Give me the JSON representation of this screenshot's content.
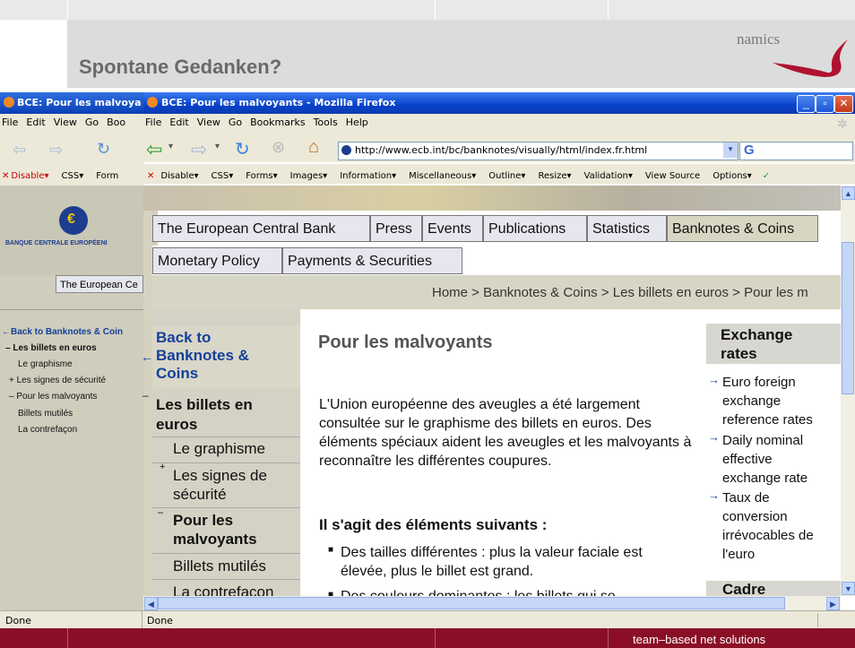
{
  "slide": {
    "title": "Spontane Gedanken?",
    "logo_text": "namics",
    "footer": "team–based net solutions"
  },
  "back_window": {
    "title": "BCE: Pour les malvoya",
    "menu": [
      "File",
      "Edit",
      "View",
      "Go",
      "Boo"
    ],
    "toolbar": [
      "Disable▾",
      "CSS▾",
      "Form"
    ],
    "bank_name": "BANQUE CENTRALE EUROPÉENI",
    "tab": "The European Ce",
    "nav": {
      "back": "←Back to Banknotes & Coin",
      "current": "– Les billets en euros",
      "items": [
        "Le graphisme",
        "+ Les signes de sécurité",
        "– Pour les malvoyants",
        "Billets mutilés",
        "La contrefaçon"
      ]
    },
    "status": "Done"
  },
  "window": {
    "title": "BCE: Pour les malvoyants - Mozilla Firefox",
    "menu": [
      "File",
      "Edit",
      "View",
      "Go",
      "Bookmarks",
      "Tools",
      "Help"
    ],
    "url": "http://www.ecb.int/bc/banknotes/visually/html/index.fr.html",
    "toolbar": [
      "Disable▾",
      "CSS▾",
      "Forms▾",
      "Images▾",
      "Information▾",
      "Miscellaneous▾",
      "Outline▾",
      "Resize▾",
      "Validation▾",
      "View Source",
      "Options▾"
    ],
    "status": "Done"
  },
  "tabs_row1": [
    "The European Central Bank",
    "Press",
    "Events",
    "Publications",
    "Statistics",
    "Banknotes & Coins"
  ],
  "tabs_row2": [
    "Monetary Policy",
    "Payments & Securities"
  ],
  "breadcrumb": "Home > Banknotes & Coins > Les billets en euros > Pour les m",
  "nav": {
    "back_arrow": "←",
    "back": [
      "Back to",
      "Banknotes &",
      "Coins"
    ],
    "section_marker": "–",
    "section": [
      "Les billets en",
      "euros"
    ],
    "items": [
      {
        "marker": "",
        "lines": [
          "Le graphisme"
        ]
      },
      {
        "marker": "+",
        "lines": [
          "Les signes de",
          "sécurité"
        ]
      },
      {
        "marker": "–",
        "lines": [
          "Pour les",
          "malvoyants"
        ]
      },
      {
        "marker": "",
        "lines": [
          "Billets mutilés"
        ]
      },
      {
        "marker": "",
        "lines": [
          "La contrefaçon"
        ]
      }
    ]
  },
  "main": {
    "heading": "Pour les malvoyants",
    "paragraph": "L'Union européenne des aveugles a été largement consultée sur le graphisme des billets en euros. Des éléments spéciaux aident les aveugles et les malvoyants à reconnaître les différentes coupures.",
    "subheading": "Il s'agit des éléments suivants :",
    "bullets": [
      "Des tailles différentes : plus la valeur faciale est élevée, plus le billet est grand.",
      "Des couleurs dominantes : les billets qui se"
    ]
  },
  "sidebar": {
    "title": [
      "Exchange",
      "rates"
    ],
    "links": [
      [
        "Euro foreign",
        "exchange",
        "reference rates"
      ],
      [
        "Daily nominal",
        "effective",
        "exchange rate"
      ],
      [
        "Taux de",
        "conversion",
        "irrévocables de",
        "l'euro"
      ]
    ],
    "cadre": "Cadre"
  },
  "colors": {
    "brand_red": "#8a0f26",
    "titlebar_blue": "#0842c9",
    "link_blue": "#14409b"
  }
}
